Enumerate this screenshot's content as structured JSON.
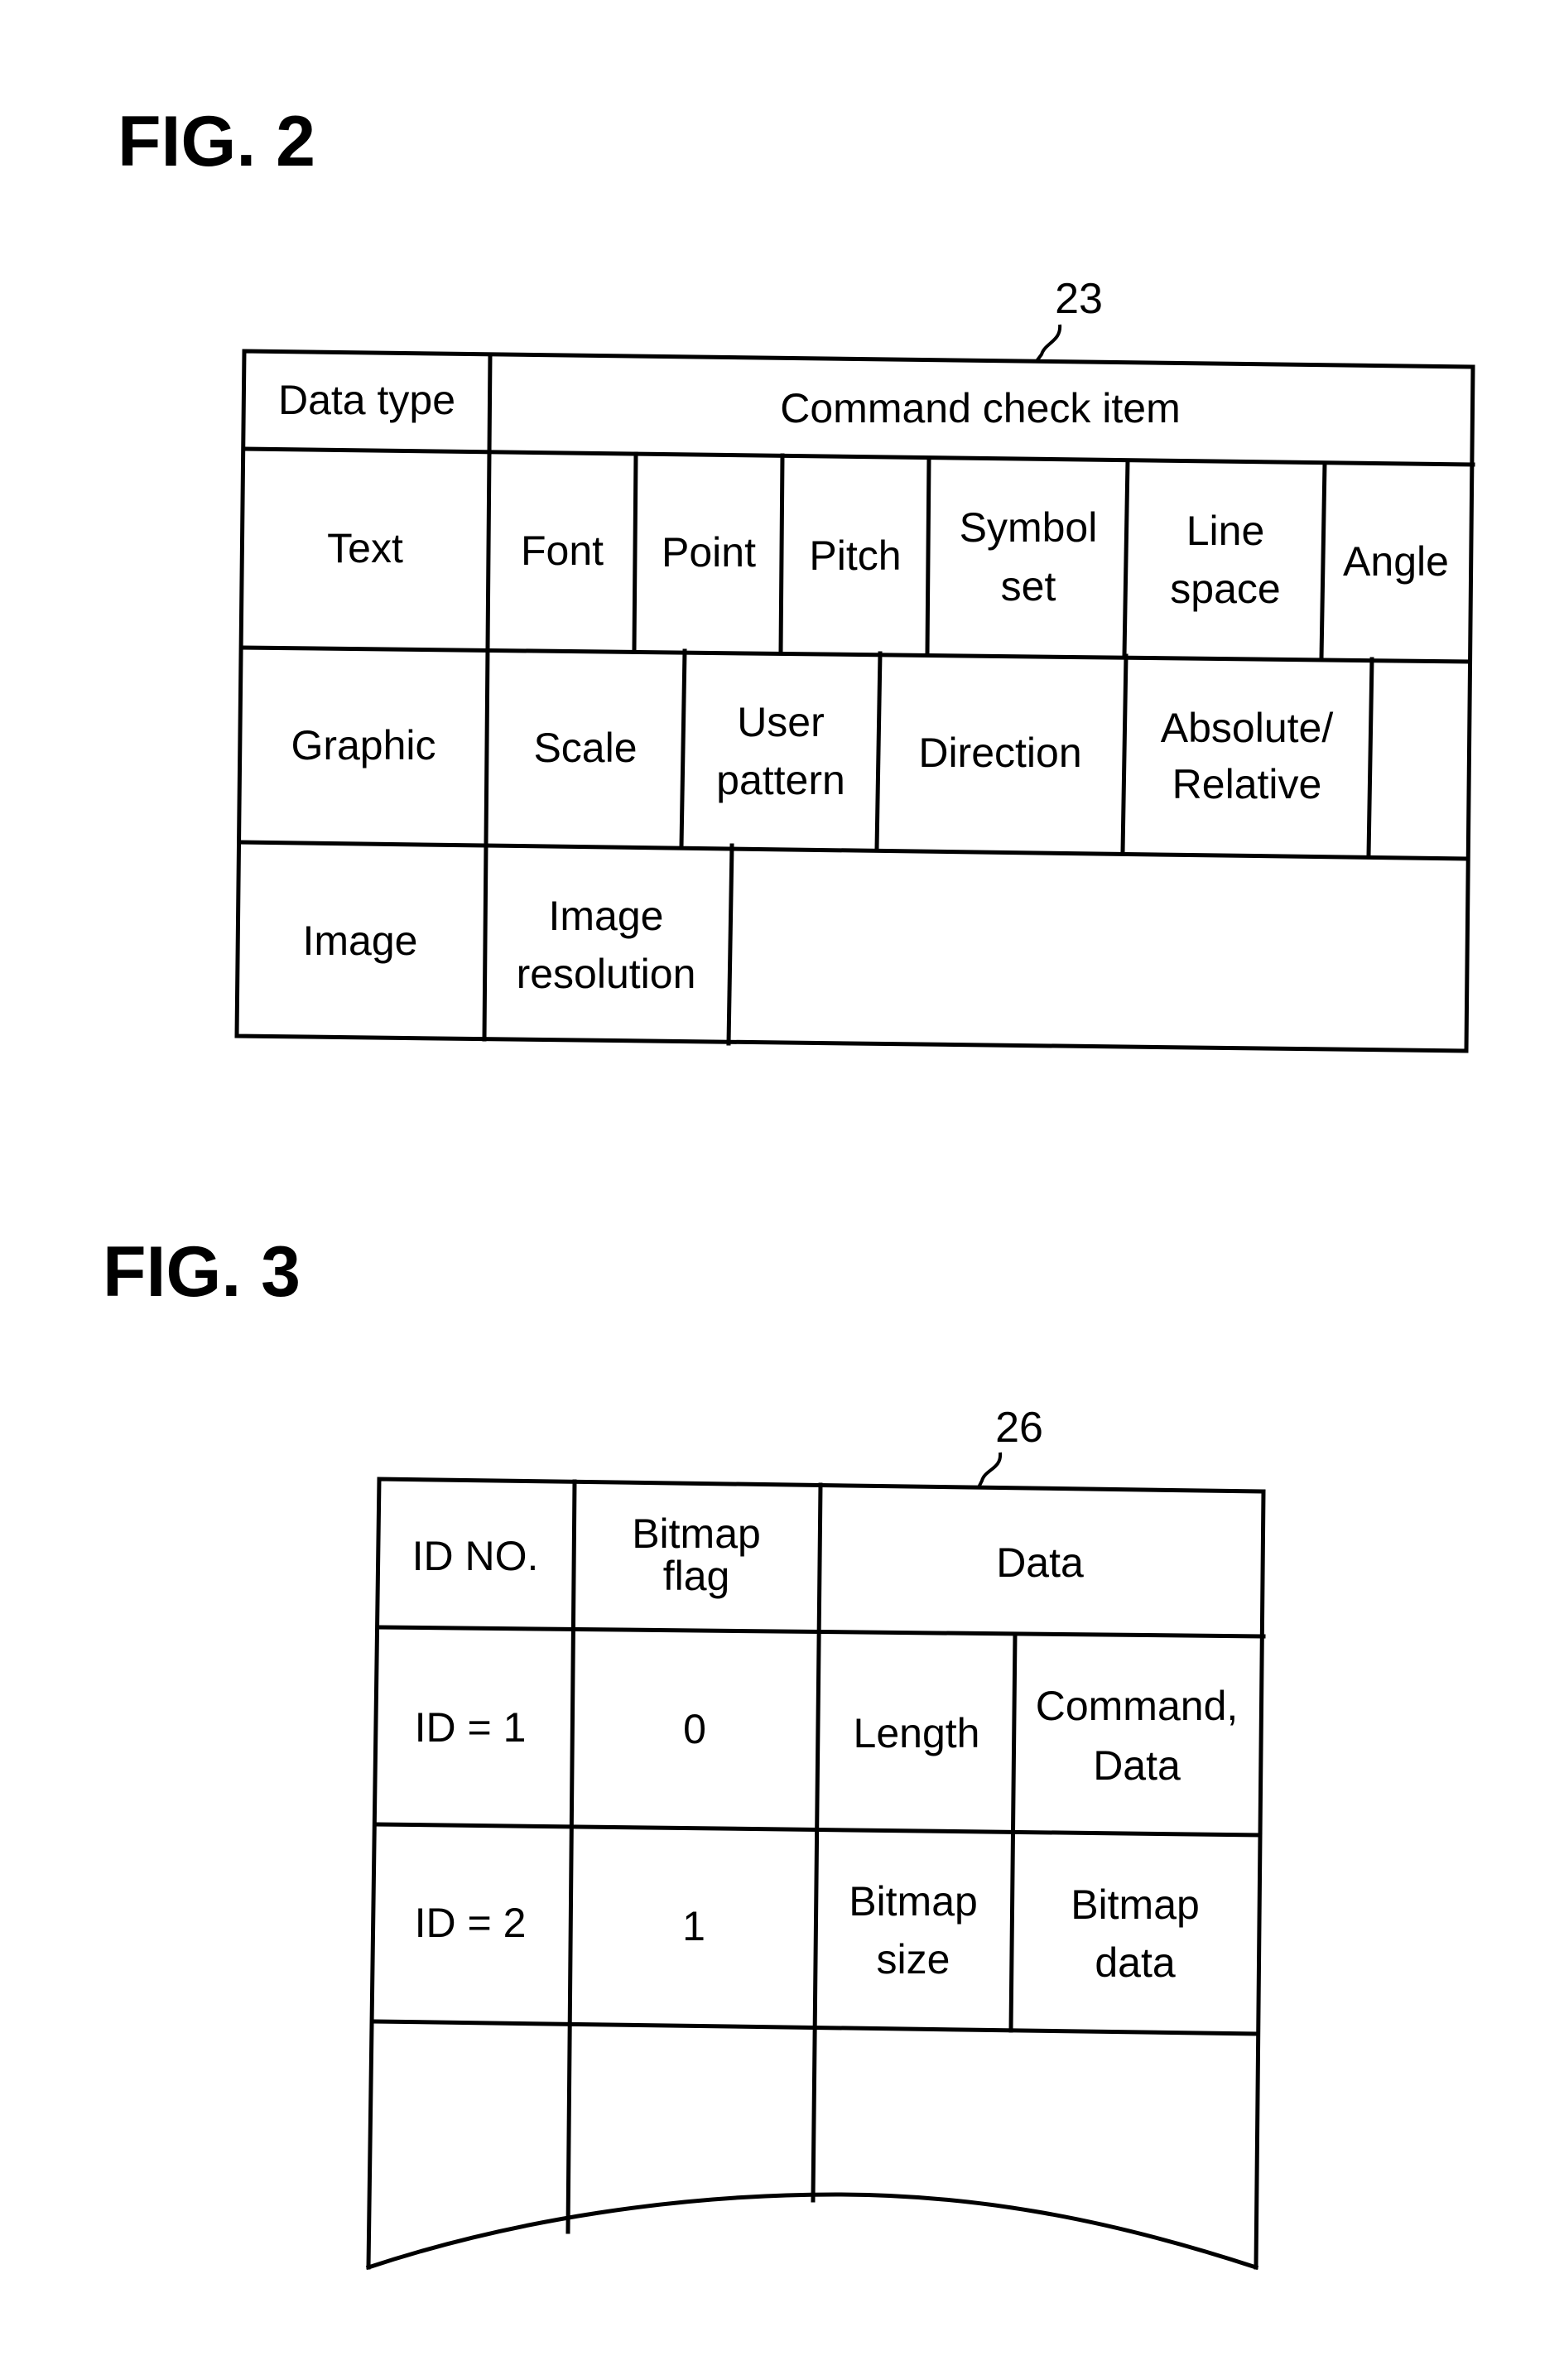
{
  "fig2": {
    "title": "FIG. 2",
    "reference_numeral": "23",
    "header": {
      "col1": "Data type",
      "col2": "Command check item"
    },
    "rows": [
      {
        "data_type": "Text",
        "items": [
          [
            "Font"
          ],
          [
            "Point"
          ],
          [
            "Pitch"
          ],
          [
            "Symbol",
            "set"
          ],
          [
            "Line",
            "space"
          ],
          [
            "Angle"
          ]
        ]
      },
      {
        "data_type": "Graphic",
        "items": [
          [
            "Scale"
          ],
          [
            "User",
            "pattern"
          ],
          [
            "Direction"
          ],
          [
            "Absolute/",
            "Relative"
          ],
          [
            ""
          ]
        ]
      },
      {
        "data_type": "Image",
        "items": [
          [
            "Image",
            "resolution"
          ],
          [
            ""
          ]
        ]
      }
    ]
  },
  "fig3": {
    "title": "FIG. 3",
    "reference_numeral": "26",
    "header": {
      "col1": "ID NO.",
      "col2": [
        "Bitmap",
        "flag"
      ],
      "col3": "Data"
    },
    "rows": [
      {
        "id": "ID = 1",
        "bitmap_flag": "0",
        "data": [
          [
            "Length"
          ],
          [
            "Command,",
            "Data"
          ]
        ]
      },
      {
        "id": "ID = 2",
        "bitmap_flag": "1",
        "data": [
          [
            "Bitmap",
            "size"
          ],
          [
            "Bitmap",
            "data"
          ]
        ]
      },
      {
        "id": "",
        "bitmap_flag": "",
        "data": [
          [
            ""
          ]
        ]
      }
    ]
  }
}
